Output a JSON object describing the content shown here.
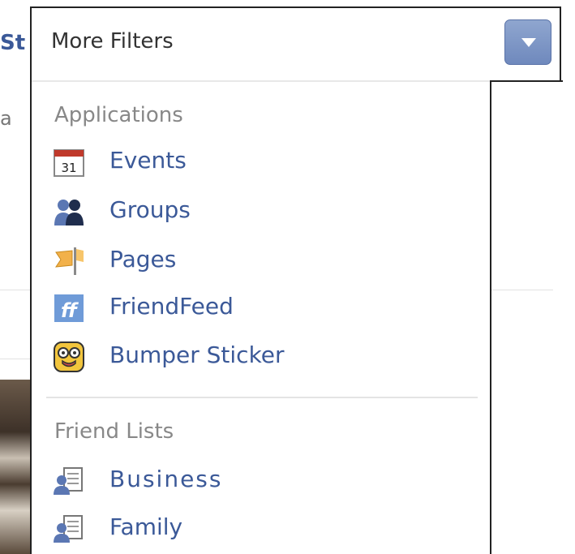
{
  "background": {
    "fragment_text": "St",
    "fragment_dot": "a"
  },
  "filter": {
    "title": "More Filters"
  },
  "sections": [
    {
      "heading": "Applications",
      "items": [
        {
          "label": "Events",
          "icon": "calendar-icon",
          "icon_text": "31"
        },
        {
          "label": "Groups",
          "icon": "group-icon"
        },
        {
          "label": "Pages",
          "icon": "pages-flag-icon"
        },
        {
          "label": "FriendFeed",
          "icon": "friendfeed-icon",
          "icon_text": "ff"
        },
        {
          "label": "Bumper Sticker",
          "icon": "bumper-sticker-icon"
        }
      ]
    },
    {
      "heading": "Friend Lists",
      "items": [
        {
          "label": "Business",
          "icon": "friend-list-icon"
        },
        {
          "label": "Family",
          "icon": "friend-list-icon"
        }
      ]
    }
  ],
  "colors": {
    "link": "#3b5998",
    "heading": "#888888",
    "toggle": "#7690c4",
    "border": "#222222"
  }
}
